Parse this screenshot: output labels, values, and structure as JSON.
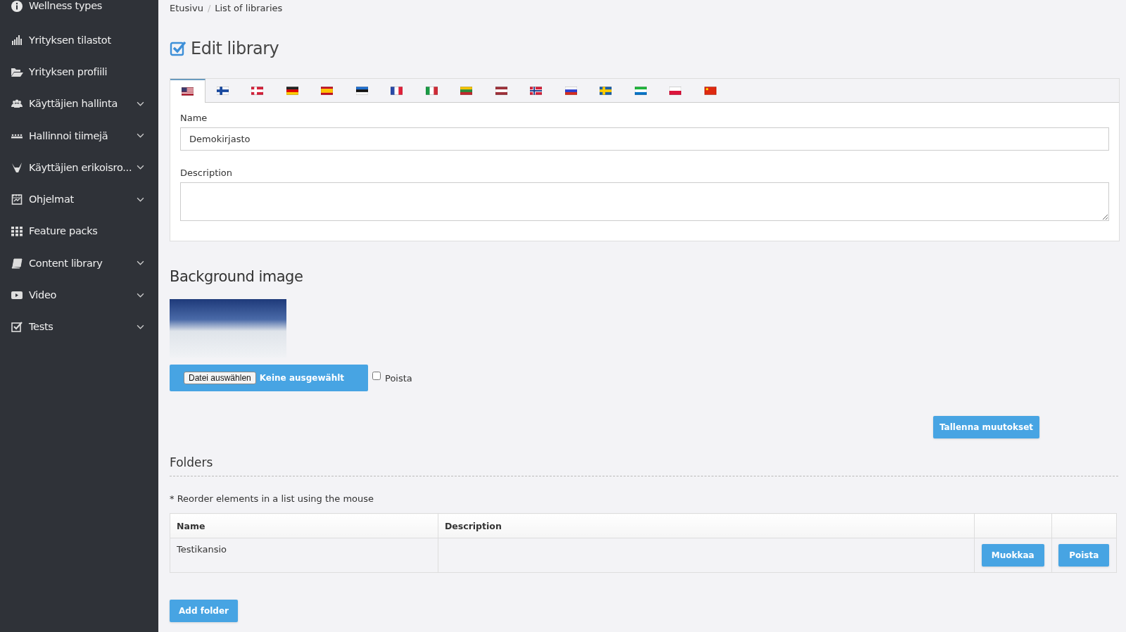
{
  "sidebar": {
    "items": [
      {
        "label": "Wellness types",
        "kind": "info",
        "expandable": false
      },
      {
        "label": "Yrityksen tilastot",
        "kind": "chart",
        "expandable": false
      },
      {
        "label": "Yrityksen profiili",
        "kind": "folder",
        "expandable": false
      },
      {
        "label": "Käyttäjien hallinta",
        "kind": "users",
        "expandable": true
      },
      {
        "label": "Hallinnoi tiimejä",
        "kind": "team",
        "expandable": true
      },
      {
        "label": "Käyttäjien erikoisro...",
        "kind": "horns",
        "expandable": true
      },
      {
        "label": "Ohjelmat",
        "kind": "calendar",
        "expandable": true
      },
      {
        "label": "Feature packs",
        "kind": "grid",
        "expandable": false
      },
      {
        "label": "Content library",
        "kind": "book",
        "expandable": true
      },
      {
        "label": "Video",
        "kind": "video",
        "expandable": true
      },
      {
        "label": "Tests",
        "kind": "check",
        "expandable": true
      }
    ]
  },
  "breadcrumb": [
    {
      "label": "Etusivu",
      "separator": "/"
    },
    {
      "label": "List of libraries"
    }
  ],
  "page_title": "Edit library",
  "language_tabs": [
    {
      "kind": "us",
      "selected": true
    },
    {
      "kind": "fi",
      "selected": false
    },
    {
      "kind": "dk",
      "selected": false
    },
    {
      "kind": "de",
      "selected": false
    },
    {
      "kind": "es",
      "selected": false
    },
    {
      "kind": "ee",
      "selected": false
    },
    {
      "kind": "fr",
      "selected": false
    },
    {
      "kind": "it",
      "selected": false
    },
    {
      "kind": "lt",
      "selected": false
    },
    {
      "kind": "lv",
      "selected": false
    },
    {
      "kind": "no",
      "selected": false
    },
    {
      "kind": "ru",
      "selected": false
    },
    {
      "kind": "se",
      "selected": false
    },
    {
      "kind": "sl",
      "selected": false
    },
    {
      "kind": "pl",
      "selected": false
    },
    {
      "kind": "cn",
      "selected": false
    }
  ],
  "form": {
    "name_label": "Name",
    "name_value": "Demokirjasto",
    "description_label": "Description"
  },
  "background_image": {
    "heading": "Background image",
    "file_button": "Datei auswählen",
    "file_status": "Keine ausgewählt",
    "remove_label": "Poista",
    "remove_checked": false
  },
  "save_button": "Tallenna muutokset",
  "folders": {
    "heading": "Folders",
    "note": "* Reorder elements in a list using the mouse",
    "columns": [
      "Name",
      "Description"
    ],
    "rows": [
      {
        "name": "Testikansio",
        "edit": "Muokkaa",
        "delete": "Poista"
      }
    ],
    "add_button": "Add folder"
  }
}
